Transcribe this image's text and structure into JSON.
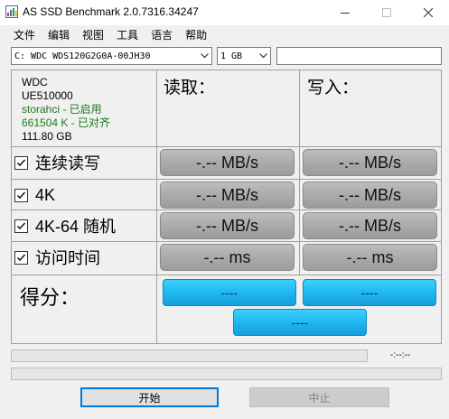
{
  "window": {
    "title": "AS SSD Benchmark 2.0.7316.34247",
    "icons": {
      "app": "chart-icon",
      "minimize": "minimize-icon",
      "maximize": "maximize-icon",
      "close": "close-icon"
    }
  },
  "menu": {
    "items": [
      "文件",
      "编辑",
      "视图",
      "工具",
      "语言",
      "帮助"
    ]
  },
  "selectors": {
    "drive": "C: WDC WDS120G2G0A-00JH30",
    "size": "1 GB",
    "extra_input": ""
  },
  "drive_info": {
    "vendor": "WDC",
    "firmware": "UE510000",
    "driver": "storahci - 已启用",
    "alignment": "661504 K - 已对齐",
    "capacity": "111.80 GB"
  },
  "columns": {
    "read": "读取：",
    "write": "写入："
  },
  "rows": [
    {
      "label": "连续读写",
      "checked": true,
      "read": "-.-- MB/s",
      "write": "-.-- MB/s"
    },
    {
      "label": "4K",
      "checked": true,
      "read": "-.-- MB/s",
      "write": "-.-- MB/s"
    },
    {
      "label": "4K-64 随机",
      "checked": true,
      "read": "-.-- MB/s",
      "write": "-.-- MB/s"
    },
    {
      "label": "访问时间",
      "checked": true,
      "read": "-.-- ms",
      "write": "-.-- ms"
    }
  ],
  "score": {
    "label": "得分：",
    "read": "----",
    "write": "----",
    "total": "----"
  },
  "progress": {
    "time": "-:--:--"
  },
  "buttons": {
    "start": "开始",
    "stop": "中止"
  },
  "colors": {
    "result_button": "#a9a9a9",
    "score_button": "#1fb4ef",
    "status_green": "#1d7a1d",
    "focus_border": "#0078d7"
  }
}
